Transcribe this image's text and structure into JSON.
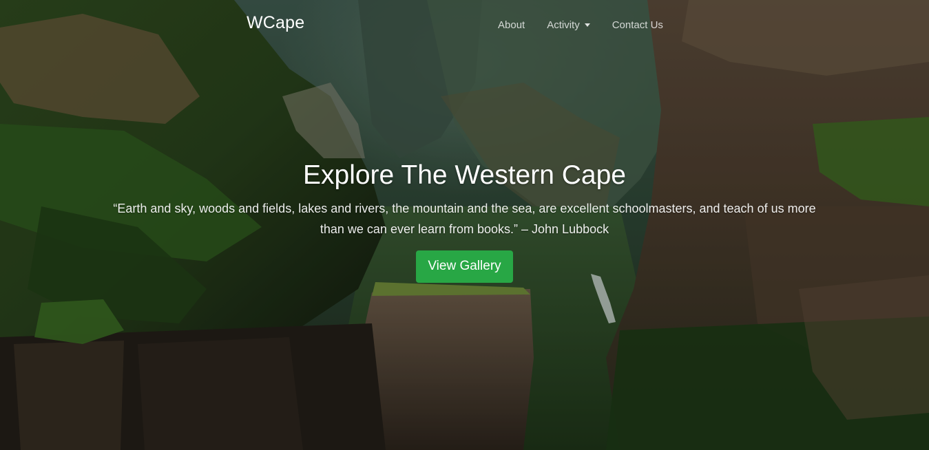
{
  "brand": "WCape",
  "nav": {
    "about": "About",
    "activity": "Activity",
    "contact": "Contact Us"
  },
  "hero": {
    "title": "Explore The Western Cape",
    "quote": "“Earth and sky, woods and fields, lakes and rivers, the mountain and the sea, are excellent schoolmasters, and teach of us more than we can ever learn from books.” – John Lubbock",
    "button_label": "View Gallery"
  },
  "colors": {
    "button": "#28a745",
    "text": "#ffffff"
  },
  "icons": {
    "activity_dropdown": "caret-down-icon"
  }
}
